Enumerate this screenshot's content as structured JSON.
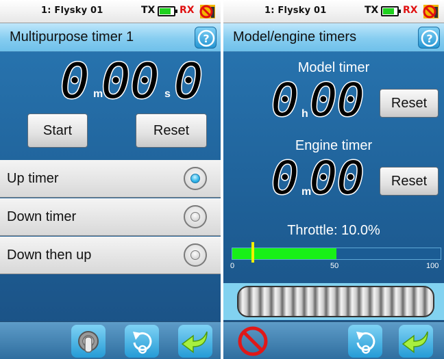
{
  "left": {
    "status": {
      "model": "1: Flysky 01",
      "tx": "TX",
      "rx": "RX"
    },
    "title": "Multipurpose timer 1",
    "timer": {
      "minutes": "0",
      "seconds": "00",
      "tenths": "0",
      "min_unit": "m",
      "sec_unit": "s"
    },
    "buttons": {
      "start": "Start",
      "reset": "Reset"
    },
    "options": [
      {
        "label": "Up timer",
        "selected": true
      },
      {
        "label": "Down timer",
        "selected": false
      },
      {
        "label": "Down then up",
        "selected": false
      }
    ],
    "toolbar": [
      "switch-icon",
      "undo-icon",
      "back-arrow-icon"
    ]
  },
  "right": {
    "status": {
      "model": "1: Flysky 01",
      "tx": "TX",
      "rx": "RX"
    },
    "title": "Model/engine timers",
    "model_timer": {
      "label": "Model timer",
      "hours": "0",
      "unit": "h",
      "minutes": "00",
      "reset": "Reset"
    },
    "engine_timer": {
      "label": "Engine timer",
      "minutes": "0",
      "unit": "m",
      "seconds": "00",
      "reset": "Reset"
    },
    "throttle": {
      "text": "Throttle: 10.0%",
      "value": 10.0,
      "bar_threshold": 50,
      "tick_labels": [
        "0",
        "50",
        "100"
      ]
    },
    "toolbar": [
      "no-entry-icon",
      "undo-icon",
      "back-arrow-icon"
    ]
  },
  "colors": {
    "accent": "#2a79b5",
    "bar_fill": "#18f018",
    "marker": "#f0f000",
    "rx": "#e01010"
  }
}
